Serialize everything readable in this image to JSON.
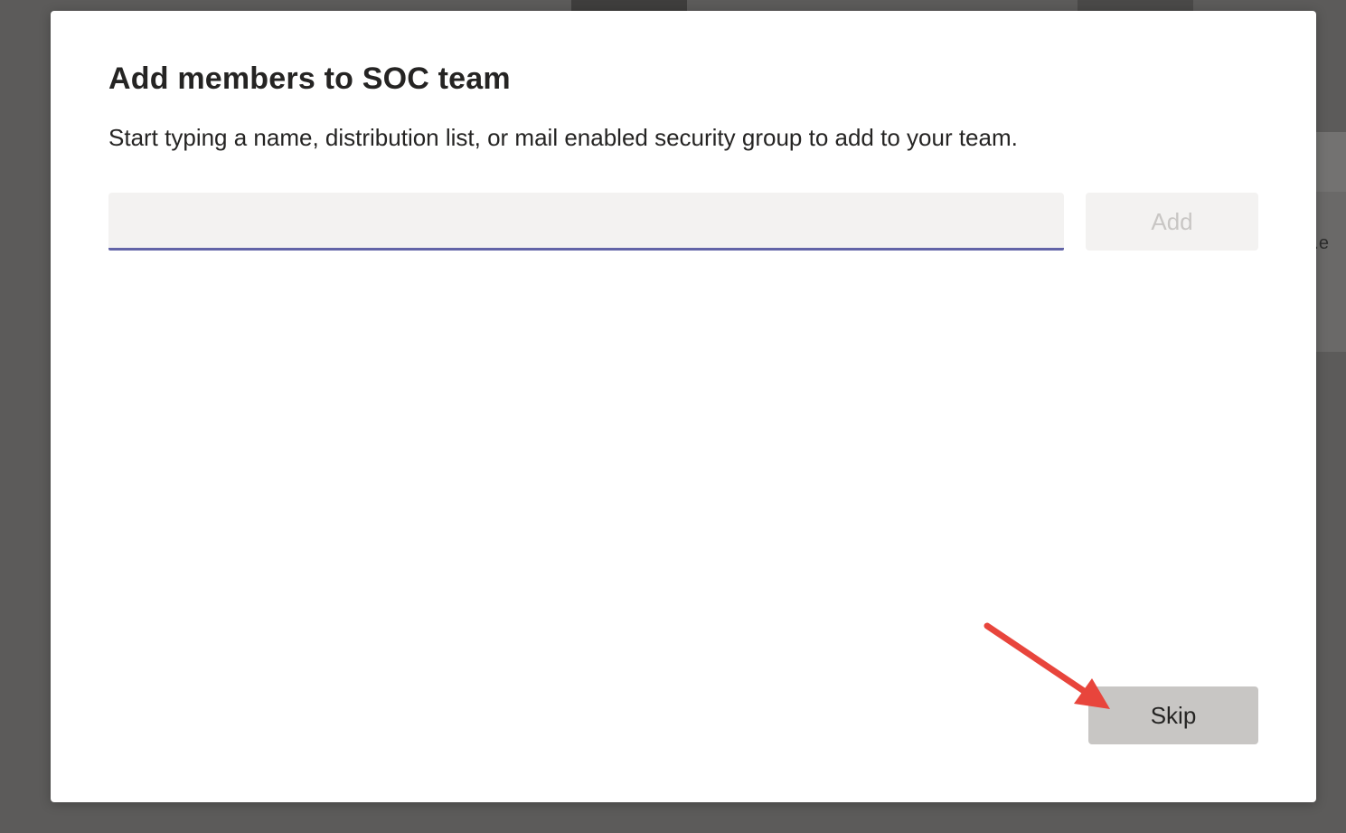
{
  "dialog": {
    "title": "Add members to SOC team",
    "subtitle": "Start typing a name, distribution list, or mail enabled security group to add to your team.",
    "input_value": "",
    "input_placeholder": "",
    "add_label": "Add",
    "skip_label": "Skip"
  },
  "background": {
    "partial_text": "e."
  },
  "colors": {
    "accent": "#6264a7",
    "annotation_arrow": "#e8453c"
  }
}
